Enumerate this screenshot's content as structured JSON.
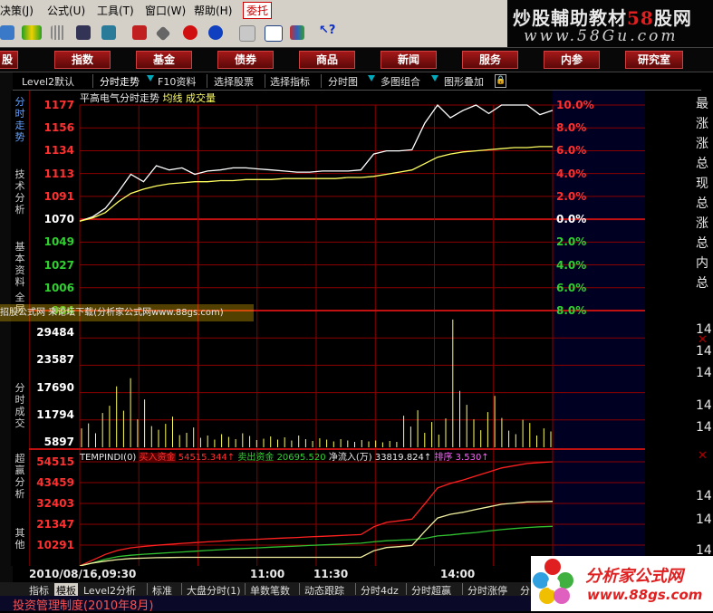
{
  "menu": {
    "items": [
      "决策(J)",
      "公式(U)",
      "工具(T)",
      "窗口(W)",
      "帮助(H)",
      "委托"
    ]
  },
  "logo": {
    "title_main": "炒股輔助教材",
    "title_num": "58",
    "title_tail": "股网",
    "url": "www.58Gu.com"
  },
  "categories": [
    "股",
    "指数",
    "基金",
    "债券",
    "商品",
    "新闻",
    "服务",
    "内参",
    "研究室"
  ],
  "subtabs": [
    "Level2默认",
    "分时走势",
    "F10资料",
    "选择股票",
    "选择指标",
    "分时图",
    "多图组合",
    "图形叠加"
  ],
  "vtabs": [
    "分时走势",
    "技术分析",
    "基本资料",
    "全屏",
    "分时成交",
    "超赢分析",
    "其他"
  ],
  "chart": {
    "title": "平高电气分时走势",
    "title_avg": "均线",
    "title_vol": "成交量",
    "price_labels": [
      "1177",
      "1156",
      "1134",
      "1113",
      "1091",
      "1070",
      "1049",
      "1027",
      "1006",
      "984"
    ],
    "pct_labels": [
      "10.0%",
      "8.0%",
      "6.0%",
      "4.0%",
      "2.0%",
      "0.0%",
      "2.0%",
      "4.0%",
      "6.0%",
      "8.0%"
    ],
    "vol_labels": [
      "29484",
      "23587",
      "17690",
      "11794",
      "5897"
    ],
    "fund_labels": [
      "54515",
      "43459",
      "32403",
      "21347",
      "10291"
    ],
    "fund_header": {
      "name": "TEMPINDI(0)",
      "buy_label": "买入资金",
      "buy_value": "54515.344↑",
      "sell_label": "卖出资金",
      "sell_value": "20695.520",
      "net_label": "净流入(万)",
      "net_value": "33819.824↑",
      "rank_label": "排序",
      "rank_value": "3.530↑"
    },
    "colors": {
      "grid": "#8b0000",
      "up": "#ff3030",
      "down": "#30d030",
      "price": "#ffffff",
      "avg": "#ffff60",
      "volume": "#ffff60",
      "buy": "#ff2020",
      "sell": "#30c030"
    }
  },
  "time_axis": [
    "2010/08/16,09:30",
    "11:00",
    "11:30",
    "14:00"
  ],
  "right_panel": {
    "top": [
      "最",
      "涨",
      "涨",
      "总",
      "现",
      "总",
      "涨",
      "总",
      "内",
      "总"
    ],
    "bottom": [
      "14",
      "14",
      "14",
      "14",
      "14",
      "14",
      "14",
      "14",
      "14",
      "14",
      "14"
    ]
  },
  "bottom_tabs": [
    "指标",
    "模板",
    "Level2分析",
    "标准",
    "大盘分时(1)",
    "单数笔数",
    "动态跟踪",
    "分时4dz",
    "分时超赢",
    "分时涨停",
    "分"
  ],
  "status": {
    "text": "投资管理制度(2010年8月)"
  },
  "watermark": {
    "text": "招股公式网 来论坛下载(分析家公式网www.88gs.com)"
  },
  "footer_logo": {
    "title": "分析家公式网",
    "url": "www.88gs.com"
  },
  "chart_data": [
    {
      "type": "line",
      "title": "平高电气分时走势",
      "xlabel": "",
      "ylabel": "",
      "x_labels": [
        "09:30",
        "11:00",
        "11:30",
        "14:00"
      ],
      "ylim": [
        984,
        1177
      ],
      "reference": 1070,
      "series": [
        {
          "name": "",
          "values": [
            1068,
            1072,
            1080,
            1095,
            1112,
            1105,
            1120,
            1116,
            1118,
            1112,
            1115,
            1116,
            1118,
            1118,
            1117,
            1116,
            1115,
            1114,
            1114,
            1115,
            1115,
            1115,
            1116,
            1131,
            1134,
            1134,
            1135,
            1160,
            1177,
            1165,
            1172,
            1177,
            1169,
            1177,
            1177,
            1177,
            1168,
            1172
          ]
        },
        {
          "name": "均线",
          "values": [
            1068,
            1071,
            1076,
            1086,
            1094,
            1098,
            1101,
            1103,
            1104,
            1105,
            1105,
            1106,
            1106,
            1107,
            1107,
            1107,
            1108,
            1108,
            1108,
            1108,
            1108,
            1109,
            1109,
            1110,
            1112,
            1114,
            1116,
            1122,
            1128,
            1131,
            1133,
            1134,
            1135,
            1136,
            1137,
            1137,
            1138,
            1138
          ]
        }
      ]
    },
    {
      "type": "bar",
      "title": "成交量",
      "ylim": [
        0,
        29484
      ],
      "values": [
        4200,
        5300,
        3100,
        7600,
        9200,
        13500,
        8100,
        15300,
        6200,
        10600,
        4700,
        3900,
        5200,
        6800,
        2700,
        3200,
        4400,
        2100,
        2600,
        1700,
        2900,
        2300,
        1800,
        3100,
        2500,
        1600,
        1900,
        2400,
        1700,
        2200,
        1500,
        2600,
        1800,
        1400,
        2000,
        1700,
        1300,
        1800,
        1500,
        1200,
        1600,
        1300,
        1500,
        1100,
        1400,
        1200,
        7000,
        4600,
        8200,
        3200,
        5600,
        2800,
        6400,
        28300,
        12500,
        9400,
        6200,
        3800,
        7800,
        11400,
        6500,
        3700,
        2900,
        6100,
        5400,
        2600,
        4200,
        3500
      ]
    },
    {
      "type": "line",
      "title": "TEMPINDI(0)",
      "ylim": [
        0,
        54515
      ],
      "series": [
        {
          "name": "买入资金",
          "values": [
            0,
            3000,
            6000,
            8200,
            9500,
            10200,
            10800,
            11300,
            11800,
            12200,
            12600,
            13000,
            13400,
            13700,
            14000,
            14300,
            14600,
            14900,
            15200,
            15500,
            15800,
            16100,
            16400,
            20500,
            22800,
            23600,
            24500,
            32500,
            40800,
            43200,
            45000,
            47100,
            49200,
            51300,
            52500,
            53600,
            54100,
            54515
          ]
        },
        {
          "name": "卖出资金",
          "values": [
            0,
            1500,
            3500,
            4900,
            5600,
            6100,
            6500,
            6900,
            7300,
            7700,
            8100,
            8500,
            8900,
            9200,
            9500,
            9800,
            10100,
            10400,
            10700,
            11000,
            11300,
            11600,
            11900,
            12600,
            13200,
            13500,
            13800,
            14400,
            15700,
            16200,
            16900,
            17500,
            18300,
            19000,
            19600,
            20100,
            20500,
            20695
          ]
        },
        {
          "name": "净流入(万)",
          "values": [
            0,
            1500,
            2500,
            3300,
            3900,
            4100,
            4300,
            4400,
            4500,
            4500,
            4500,
            4500,
            4500,
            4500,
            4500,
            4500,
            4500,
            4500,
            4500,
            4500,
            4500,
            4500,
            4500,
            7900,
            9600,
            10100,
            10700,
            18100,
            25100,
            27000,
            28100,
            29600,
            30900,
            32300,
            32900,
            33500,
            33600,
            33819
          ]
        }
      ]
    }
  ]
}
